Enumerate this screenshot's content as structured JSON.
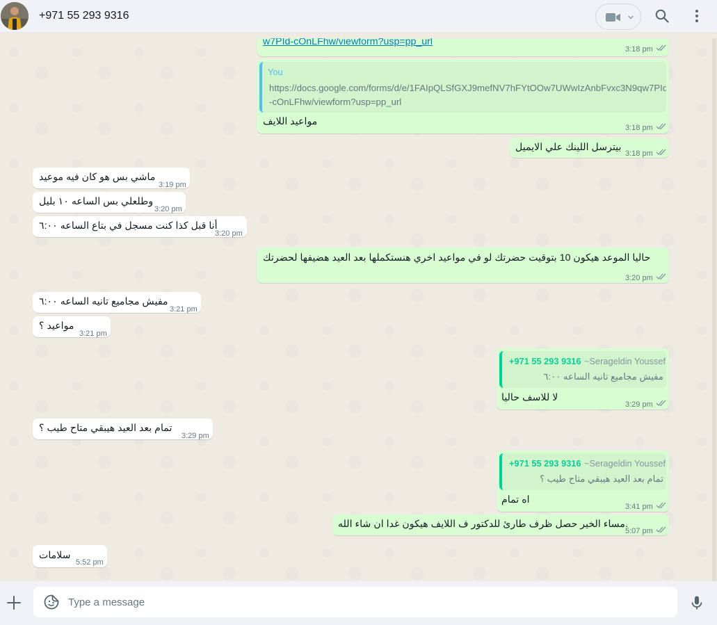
{
  "header": {
    "contact_name": "+971 55 293 9316"
  },
  "icons": {
    "avatar": "avatar-photo",
    "video": "video-camera-icon",
    "dropdown": "chevron-down-icon",
    "search": "search-icon",
    "menu": "more-vertical-icon",
    "ticks": "double-check-icon",
    "attach": "plus-icon",
    "sticker": "sticker-icon",
    "mic": "microphone-icon"
  },
  "colors": {
    "outgoing_bubble": "#d9fdd3",
    "incoming_bubble": "#ffffff",
    "chat_background": "#efeae2",
    "quote_you_accent": "#53bdeb",
    "quote_contact_accent": "#06cf9c",
    "link": "#027eb5"
  },
  "messages": [
    {
      "dir": "out",
      "link": "w7PId-cOnLFhw/viewform?usp=pp_url",
      "time": "3:18 pm"
    },
    {
      "dir": "out",
      "quote_author": "You",
      "quote_text_1": "https://docs.google.com/forms/d/e/1FAIpQLSfGXJ9mefNV7hFYtOOw7UWwIzAnbFvxc3N9qw7PId",
      "quote_text_2": "-cOnLFhw/viewform?usp=pp_url",
      "text": "مواعيد اللايف",
      "time": "3:18 pm"
    },
    {
      "dir": "out",
      "text": "بيترسل اللينك علي الايميل",
      "time": "3:18 pm"
    },
    {
      "dir": "in",
      "text": "ماشي بس هو كان فيه موعيد",
      "time": "3:19 pm"
    },
    {
      "dir": "in",
      "text": "وطلعلي بس الساعه ١٠ بليل",
      "time": "3:20 pm"
    },
    {
      "dir": "in",
      "text": "أنا قبل كذا كنت مسجل في بتاع الساعه ٦:٠٠",
      "time": "3:20 pm"
    },
    {
      "dir": "out",
      "text": "حاليا الموعد هيكون 10 بتوقيت حضرتك  لو في مواعيد اخري هنستكملها بعد العيد هضيفها لحضرتك",
      "time": "3:20 pm"
    },
    {
      "dir": "in",
      "text": "مفيش مجاميع تانيه الساعه ٦:٠٠",
      "time": "3:21 pm"
    },
    {
      "dir": "in",
      "text": "مواعيد ؟",
      "time": "3:21 pm"
    },
    {
      "dir": "out",
      "quote_phone": "+971 55 293 9316",
      "quote_name": "~Serageldin Youssef",
      "quote_text": "مفيش مجاميع تانيه الساعه ٦:٠٠",
      "text": "لا للاسف حاليا",
      "time": "3:29 pm"
    },
    {
      "dir": "in",
      "text": "تمام بعد العيد هيبقي متاح طيب ؟",
      "time": "3:29 pm"
    },
    {
      "dir": "out",
      "quote_phone": "+971 55 293 9316",
      "quote_name": "~Serageldin Youssef",
      "quote_text": "تمام بعد العيد هيبقي متاح طيب ؟",
      "text": "اه تمام",
      "time": "3:41 pm"
    },
    {
      "dir": "out",
      "text": "مساء الخير  حصل ظرف طارئ للدكتور ف اللايف هيكون غدا ان شاء الله.",
      "time": "5:07 pm"
    },
    {
      "dir": "in",
      "text": "سلامات",
      "time": "5:52 pm"
    }
  ],
  "composer": {
    "placeholder": "Type a message"
  }
}
